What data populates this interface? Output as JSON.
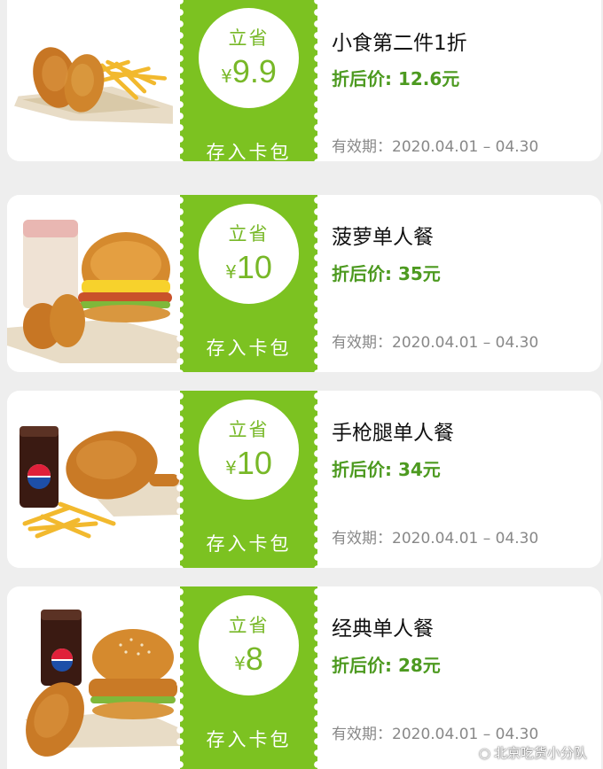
{
  "coupons": [
    {
      "save_label": "立省",
      "currency": "¥",
      "amount": "9.9",
      "wallet_label": "存入卡包",
      "title": "小食第二件1折",
      "price": "折后价: 12.6元",
      "validity": "有效期：2020.04.01 – 04.30",
      "image_icon": "chicken-wings-and-fries-icon"
    },
    {
      "save_label": "立省",
      "currency": "¥",
      "amount": "10",
      "wallet_label": "存入卡包",
      "title": "菠萝单人餐",
      "price": "折后价: 35元",
      "validity": "有效期：2020.04.01 – 04.30",
      "image_icon": "pineapple-burger-meal-icon"
    },
    {
      "save_label": "立省",
      "currency": "¥",
      "amount": "10",
      "wallet_label": "存入卡包",
      "title": "手枪腿单人餐",
      "price": "折后价: 34元",
      "validity": "有效期：2020.04.01 – 04.30",
      "image_icon": "chicken-leg-meal-icon"
    },
    {
      "save_label": "立省",
      "currency": "¥",
      "amount": "8",
      "wallet_label": "存入卡包",
      "title": "经典单人餐",
      "price": "折后价: 28元",
      "validity": "有效期：2020.04.01 – 04.30",
      "image_icon": "classic-burger-meal-icon"
    }
  ],
  "watermark": "北京吃货小分队",
  "colors": {
    "stub_green": "#7cc221",
    "price_green": "#4d9a20",
    "amount_green": "#78b828",
    "background": "#eeeeee"
  }
}
